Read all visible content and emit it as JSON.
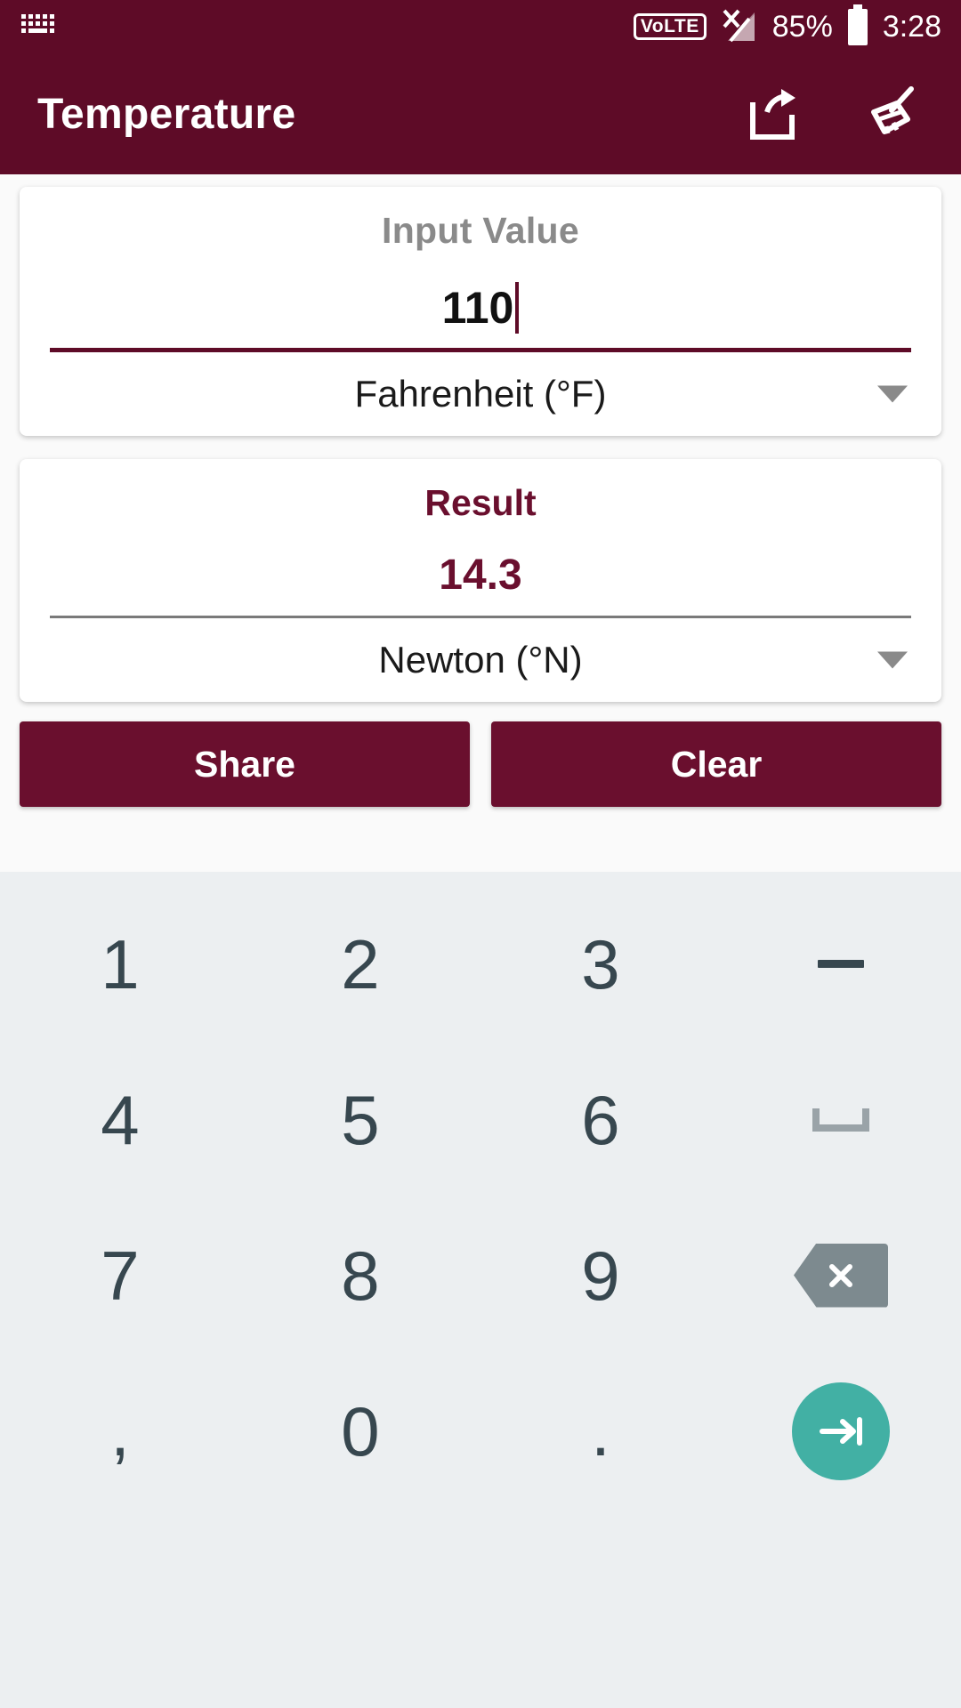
{
  "status_bar": {
    "keyboard_icon": "keyboard-icon",
    "volte_label": "VoLTE",
    "signal_icon": "signal-no-service-icon",
    "battery_percent": "85%",
    "battery_icon": "battery-icon",
    "time": "3:28"
  },
  "app_bar": {
    "title": "Temperature",
    "share_icon": "share-icon",
    "clear_icon": "broom-icon",
    "background": "#5e0b27"
  },
  "input_card": {
    "label": "Input Value",
    "value": "110",
    "unit": "Fahrenheit (°F)",
    "dropdown_icon": "chevron-down-icon",
    "accent": "#5e0b27"
  },
  "result_card": {
    "label": "Result",
    "value": "14.3",
    "unit": "Newton (°N)",
    "dropdown_icon": "chevron-down-icon",
    "accent": "#6a0f2e"
  },
  "actions": {
    "share_label": "Share",
    "clear_label": "Clear",
    "button_color": "#6a0f2e"
  },
  "keyboard": {
    "background": "#eceff1",
    "key_color": "#37474f",
    "enter_color": "#42b0a4",
    "rows": [
      [
        {
          "label": "1",
          "name": "key-1",
          "type": "num"
        },
        {
          "label": "2",
          "name": "key-2",
          "type": "num"
        },
        {
          "label": "3",
          "name": "key-3",
          "type": "num"
        },
        {
          "label": "−",
          "name": "key-minus",
          "type": "glyph"
        }
      ],
      [
        {
          "label": "4",
          "name": "key-4",
          "type": "num"
        },
        {
          "label": "5",
          "name": "key-5",
          "type": "num"
        },
        {
          "label": "6",
          "name": "key-6",
          "type": "num"
        },
        {
          "label": "␣",
          "name": "key-space",
          "type": "glyph"
        }
      ],
      [
        {
          "label": "7",
          "name": "key-7",
          "type": "num"
        },
        {
          "label": "8",
          "name": "key-8",
          "type": "num"
        },
        {
          "label": "9",
          "name": "key-9",
          "type": "num"
        },
        {
          "label": "⌧",
          "name": "key-backspace",
          "type": "glyph"
        }
      ],
      [
        {
          "label": ",",
          "name": "key-comma",
          "type": "num"
        },
        {
          "label": "0",
          "name": "key-0",
          "type": "num"
        },
        {
          "label": ".",
          "name": "key-period",
          "type": "num"
        },
        {
          "label": "→|",
          "name": "key-enter",
          "type": "glyph"
        }
      ]
    ]
  }
}
